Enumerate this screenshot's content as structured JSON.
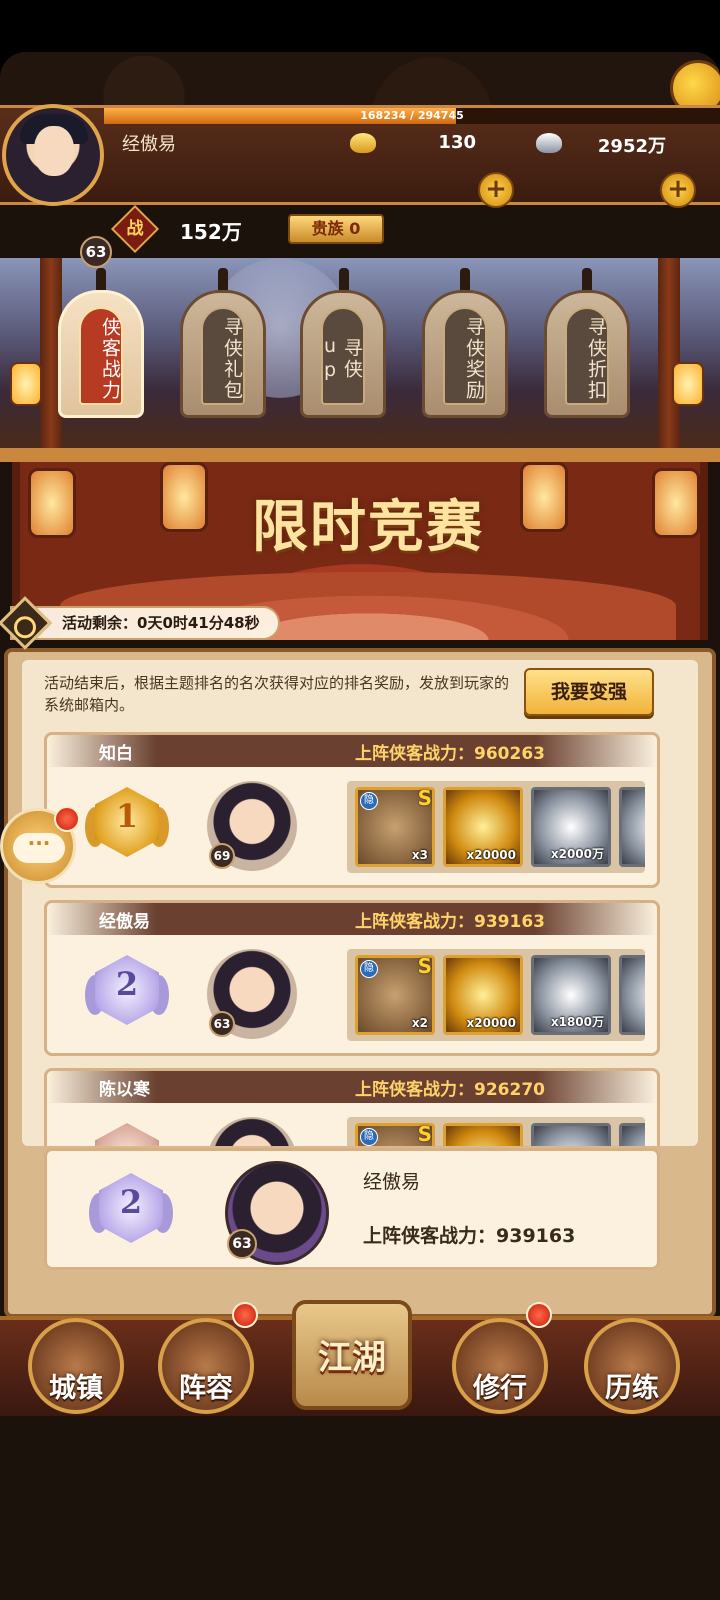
{
  "header": {
    "exp_text": "168234 / 294745",
    "exp_fraction": 0.571,
    "player_name": "经傲易",
    "player_level": "63",
    "gold": "130",
    "silver": "2952万",
    "power_icon": "战",
    "power": "152万",
    "noble": "贵族 0",
    "plus_glyph": "+"
  },
  "tabs": [
    {
      "label": "侠客战力",
      "active": true
    },
    {
      "label": "寻侠礼包",
      "active": false
    },
    {
      "label": "寻侠up",
      "active": false
    },
    {
      "label": "寻侠奖励",
      "active": false
    },
    {
      "label": "寻侠折扣",
      "active": false
    }
  ],
  "banner": {
    "title": "限时竞赛",
    "timer": "活动剩余：0天0时41分48秒"
  },
  "panel": {
    "description": "活动结束后，根据主题排名的名次获得对应的排名奖励，发放到玩家的系统邮箱内。",
    "strong_button": "我要变强",
    "power_label": "上阵侠客战力：",
    "hidden_tag": "隐",
    "s_tag": "S"
  },
  "rankings": [
    {
      "rank": "1",
      "name": "知白",
      "power": "960263",
      "level": "69",
      "rewards": [
        {
          "type": "hero",
          "count": "x3"
        },
        {
          "type": "gold",
          "count": "x20000"
        },
        {
          "type": "silver",
          "count": "x2000万"
        }
      ]
    },
    {
      "rank": "2",
      "name": "经傲易",
      "power": "939163",
      "level": "63",
      "rewards": [
        {
          "type": "hero",
          "count": "x2"
        },
        {
          "type": "gold",
          "count": "x20000"
        },
        {
          "type": "silver",
          "count": "x1800万"
        }
      ]
    },
    {
      "rank": "3",
      "name": "陈以寒",
      "power": "926270",
      "level": "",
      "rewards": []
    }
  ],
  "my_rank": {
    "rank": "2",
    "name": "经傲易",
    "level": "63",
    "power_text": "上阵侠客战力：939163"
  },
  "chat": {
    "dots": "···"
  },
  "nav": [
    {
      "label": "城镇",
      "badge": false
    },
    {
      "label": "阵容",
      "badge": true
    },
    {
      "label": "江湖",
      "badge": false
    },
    {
      "label": "修行",
      "badge": true
    },
    {
      "label": "历练",
      "badge": false
    }
  ],
  "colors": {
    "accent": "#c9883e",
    "active_tab": "#b73a22",
    "badge": "#c81a0a"
  }
}
